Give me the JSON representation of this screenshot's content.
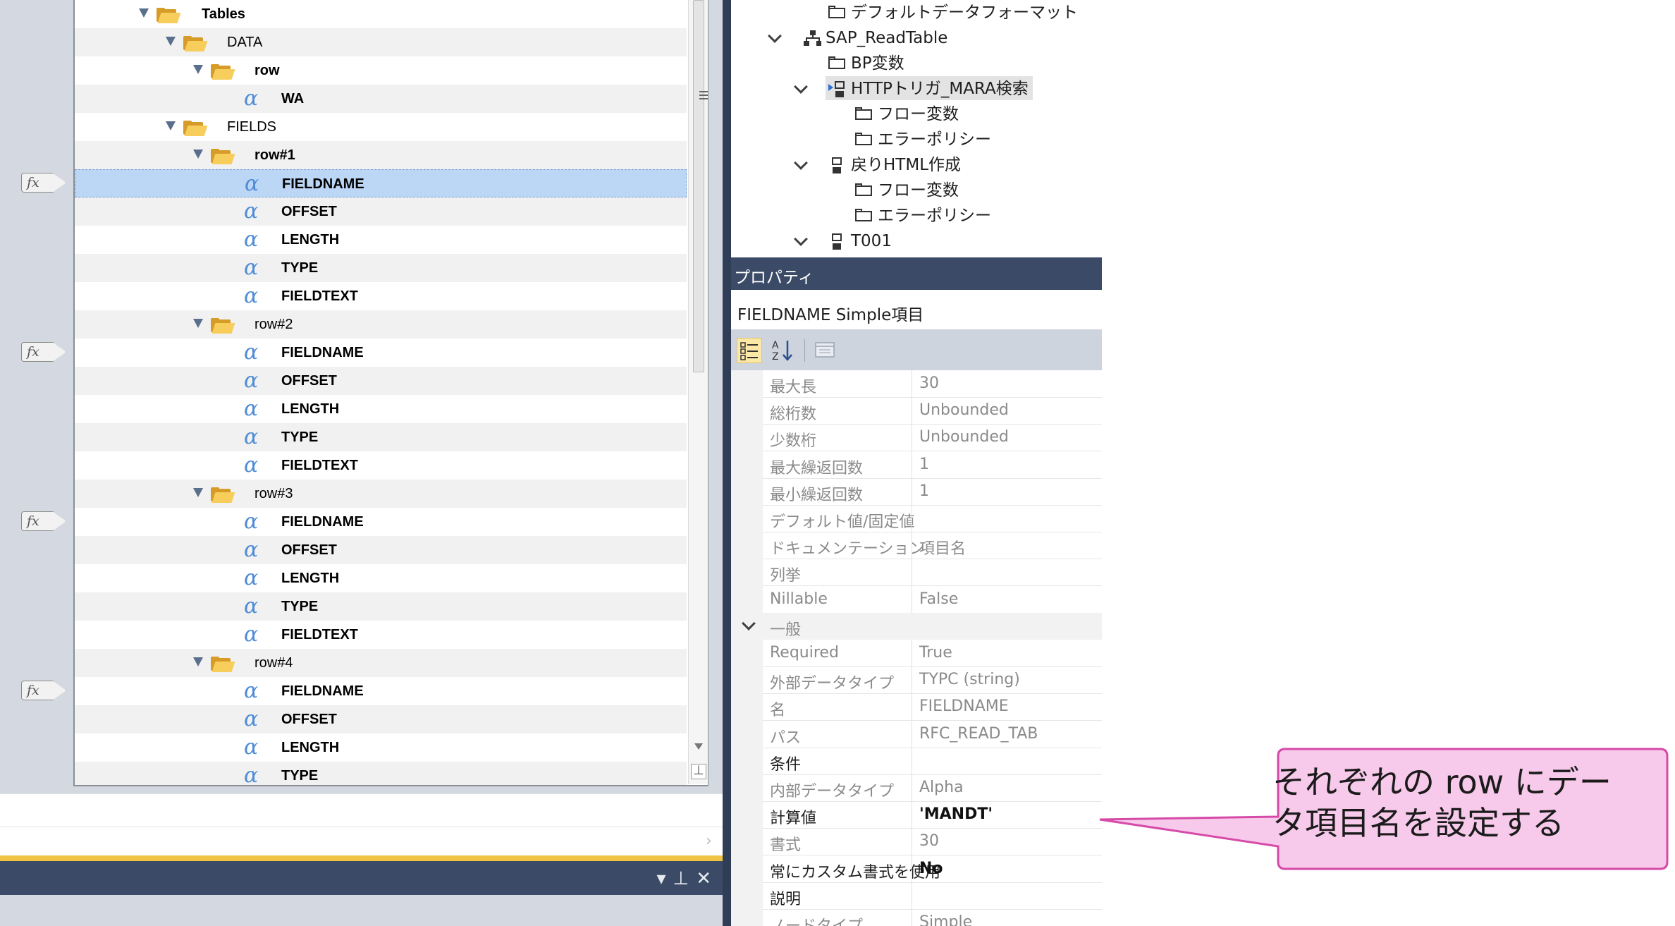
{
  "tree": {
    "rows": [
      {
        "label": "Tables",
        "type": "folder",
        "level": 0,
        "bold": true
      },
      {
        "label": "DATA",
        "type": "folder",
        "level": 1,
        "bold": false
      },
      {
        "label": "row",
        "type": "folder-open",
        "level": 2,
        "bold": true
      },
      {
        "label": "WA",
        "type": "alpha",
        "level": 3,
        "bold": true
      },
      {
        "label": "FIELDS",
        "type": "folder",
        "level": 1,
        "bold": false
      },
      {
        "label": "row#1",
        "type": "folder",
        "level": 2,
        "bold": true
      },
      {
        "label": "FIELDNAME",
        "type": "alpha",
        "level": 3,
        "bold": true,
        "selected": true
      },
      {
        "label": "OFFSET",
        "type": "alpha",
        "level": 3,
        "bold": true
      },
      {
        "label": "LENGTH",
        "type": "alpha",
        "level": 3,
        "bold": true
      },
      {
        "label": "TYPE",
        "type": "alpha",
        "level": 3,
        "bold": true
      },
      {
        "label": "FIELDTEXT",
        "type": "alpha",
        "level": 3,
        "bold": true
      },
      {
        "label": "row#2",
        "type": "folder",
        "level": 2,
        "bold": false
      },
      {
        "label": "FIELDNAME",
        "type": "alpha",
        "level": 3,
        "bold": true
      },
      {
        "label": "OFFSET",
        "type": "alpha",
        "level": 3,
        "bold": true
      },
      {
        "label": "LENGTH",
        "type": "alpha",
        "level": 3,
        "bold": true
      },
      {
        "label": "TYPE",
        "type": "alpha",
        "level": 3,
        "bold": true
      },
      {
        "label": "FIELDTEXT",
        "type": "alpha",
        "level": 3,
        "bold": true
      },
      {
        "label": "row#3",
        "type": "folder",
        "level": 2,
        "bold": false
      },
      {
        "label": "FIELDNAME",
        "type": "alpha",
        "level": 3,
        "bold": true
      },
      {
        "label": "OFFSET",
        "type": "alpha",
        "level": 3,
        "bold": true
      },
      {
        "label": "LENGTH",
        "type": "alpha",
        "level": 3,
        "bold": true
      },
      {
        "label": "TYPE",
        "type": "alpha",
        "level": 3,
        "bold": true
      },
      {
        "label": "FIELDTEXT",
        "type": "alpha",
        "level": 3,
        "bold": true
      },
      {
        "label": "row#4",
        "type": "folder",
        "level": 2,
        "bold": false
      },
      {
        "label": "FIELDNAME",
        "type": "alpha",
        "level": 3,
        "bold": true
      },
      {
        "label": "OFFSET",
        "type": "alpha",
        "level": 3,
        "bold": true
      },
      {
        "label": "LENGTH",
        "type": "alpha",
        "level": 3,
        "bold": true
      },
      {
        "label": "TYPE",
        "type": "alpha",
        "level": 3,
        "bold": true
      }
    ],
    "fx_label": "fx",
    "alpha_glyph": "α"
  },
  "solution_tree": {
    "items": [
      {
        "label": "デフォルトデータフォーマット",
        "icon": "folder"
      },
      {
        "label": "SAP_ReadTable",
        "icon": "network"
      },
      {
        "label": "BP変数",
        "icon": "folder"
      },
      {
        "label": "HTTPトリガ_MARA検索",
        "icon": "trigger"
      },
      {
        "label": "フロー変数",
        "icon": "folder"
      },
      {
        "label": "エラーポリシー",
        "icon": "folder"
      },
      {
        "label": "戻りHTML作成",
        "icon": "component"
      },
      {
        "label": "フロー変数",
        "icon": "folder"
      },
      {
        "label": "エラーポリシー",
        "icon": "folder"
      },
      {
        "label": "T001",
        "icon": "component"
      }
    ]
  },
  "properties": {
    "header": "プロパティ",
    "title": "FIELDNAME Simple項目",
    "rows": [
      {
        "name": "最大長",
        "value": "30"
      },
      {
        "name": "総桁数",
        "value": "Unbounded"
      },
      {
        "name": "少数桁",
        "value": "Unbounded"
      },
      {
        "name": "最大繰返回数",
        "value": "1"
      },
      {
        "name": "最小繰返回数",
        "value": "1"
      },
      {
        "name": "デフォルト値/固定値",
        "value": ""
      },
      {
        "name": "ドキュメンテーション",
        "value": "項目名"
      },
      {
        "name": "列挙",
        "value": ""
      },
      {
        "name": "Nillable",
        "value": "False"
      },
      {
        "category": "一般"
      },
      {
        "name": "Required",
        "value": "True"
      },
      {
        "name": "外部データタイプ",
        "value": "TYPC (string)"
      },
      {
        "name": "名",
        "value": "FIELDNAME"
      },
      {
        "name": "パス",
        "value": "RFC_READ_TAB"
      },
      {
        "name": "条件",
        "value": "",
        "dark": true
      },
      {
        "name": "内部データタイプ",
        "value": "Alpha"
      },
      {
        "name": "計算値",
        "value": "'MANDT'",
        "dark": true,
        "bold": true
      },
      {
        "name": "書式",
        "value": "30"
      },
      {
        "name": "常にカスタム書式を使用",
        "value": "No",
        "dark": true,
        "bold": true
      },
      {
        "name": "説明",
        "value": "",
        "dark": true
      },
      {
        "name": "ノードタイプ",
        "value": "Simple"
      }
    ]
  },
  "callout": {
    "line1": "それぞれの row にデー",
    "line2": "タ項目名を設定する"
  },
  "colors": {
    "selection": "#bcd6f5",
    "navy": "#3b4a66",
    "gold": "#f0c342",
    "callout_fill": "#f7c9ea",
    "callout_border": "#d64aa8"
  }
}
